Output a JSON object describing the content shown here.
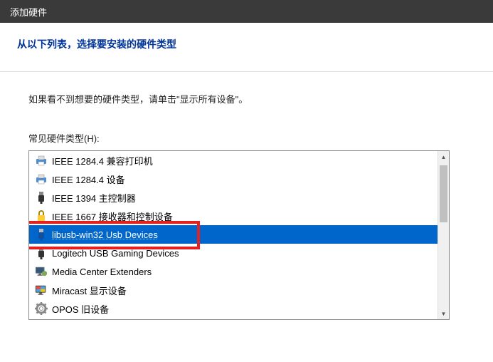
{
  "title": "添加硬件",
  "header_title": "从以下列表，选择要安装的硬件类型",
  "instruction": "如果看不到想要的硬件类型，请单击\"显示所有设备\"。",
  "list_label": "常见硬件类型(H):",
  "items": [
    {
      "label": "IEEE 1284.4 兼容打印机",
      "icon": "printer-icon"
    },
    {
      "label": "IEEE 1284.4 设备",
      "icon": "printer-icon"
    },
    {
      "label": "IEEE 1394 主控制器",
      "icon": "usb-plug-icon"
    },
    {
      "label": "IEEE 1667 接收器和控制设备",
      "icon": "lock-device-icon"
    },
    {
      "label": "libusb-win32 Usb Devices",
      "icon": "usb-plug-blue-icon",
      "selected": true
    },
    {
      "label": "Logitech USB Gaming Devices",
      "icon": "usb-plug-icon"
    },
    {
      "label": "Media Center Extenders",
      "icon": "monitor-icon"
    },
    {
      "label": "Miracast 显示设备",
      "icon": "monitor-color-icon"
    },
    {
      "label": "OPOS 旧设备",
      "icon": "gear-icon"
    }
  ]
}
